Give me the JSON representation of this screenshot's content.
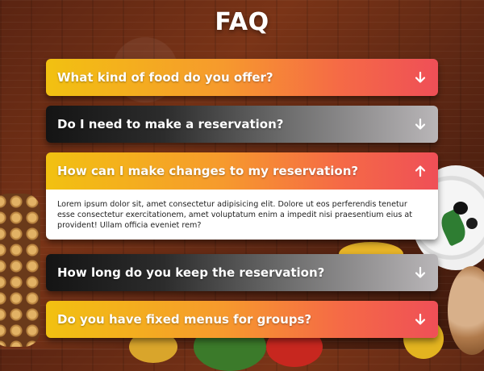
{
  "page": {
    "title": "FAQ"
  },
  "faq": [
    {
      "question": "What kind of food do you offer?",
      "expanded": false,
      "style": "orange",
      "icon": "arrow-down-icon"
    },
    {
      "question": "Do I need to make a reservation?",
      "expanded": false,
      "style": "dark",
      "icon": "arrow-down-icon"
    },
    {
      "question": "How can I make changes to my reservation?",
      "expanded": true,
      "style": "orange",
      "icon": "arrow-up-icon",
      "answer": "Lorem ipsum dolor sit, amet consectetur adipisicing elit. Dolore ut eos perferendis tenetur esse consectetur exercitationem, amet voluptatum enim a impedit nisi praesentium eius at provident! Ullam officia eveniet rem?"
    },
    {
      "question": "How long do you keep the reservation?",
      "expanded": false,
      "style": "dark",
      "icon": "arrow-down-icon"
    },
    {
      "question": "Do you have fixed menus for groups?",
      "expanded": false,
      "style": "orange",
      "icon": "arrow-down-icon"
    }
  ],
  "colors": {
    "orange_gradient": [
      "#f2c111",
      "#f69a2d",
      "#f56a46",
      "#ef4f57"
    ],
    "dark_gradient": [
      "#141414",
      "#2c2c2c",
      "#6a6a6a",
      "#b9b6b8"
    ],
    "answer_background": "#ffffff"
  }
}
